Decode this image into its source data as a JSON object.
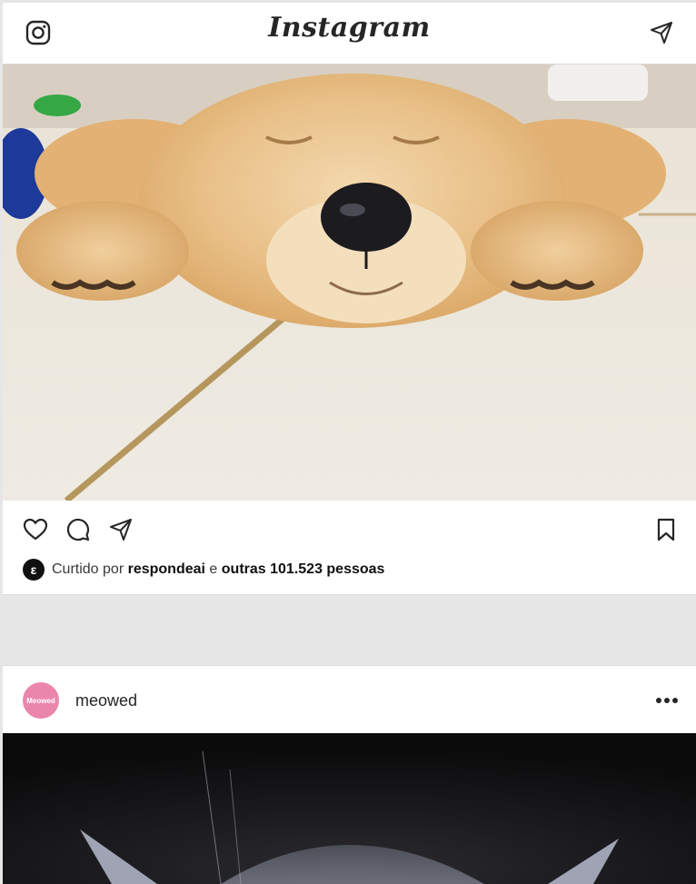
{
  "header": {
    "logo_text": "Instagram",
    "left_icon": "instagram-camera-icon",
    "right_icon": "direct-send-icon"
  },
  "post1": {
    "image_icon": "puppy-photo",
    "actions": [
      "heart-icon",
      "comment-icon",
      "share-icon",
      "bookmark-icon"
    ],
    "likes": {
      "prefix": "Curtido por",
      "user": "respondeai",
      "middle": "e",
      "others": "outras 101.523 pessoas",
      "avatar_glyph": "ε"
    }
  },
  "post2": {
    "avatar_text": "Meowed",
    "username": "meowed",
    "more_icon": "more-options-icon"
  },
  "colors": {
    "background": "#e6e6e6",
    "card": "#ffffff",
    "text": "#262626",
    "avatar_pink": "#ea86ac"
  }
}
